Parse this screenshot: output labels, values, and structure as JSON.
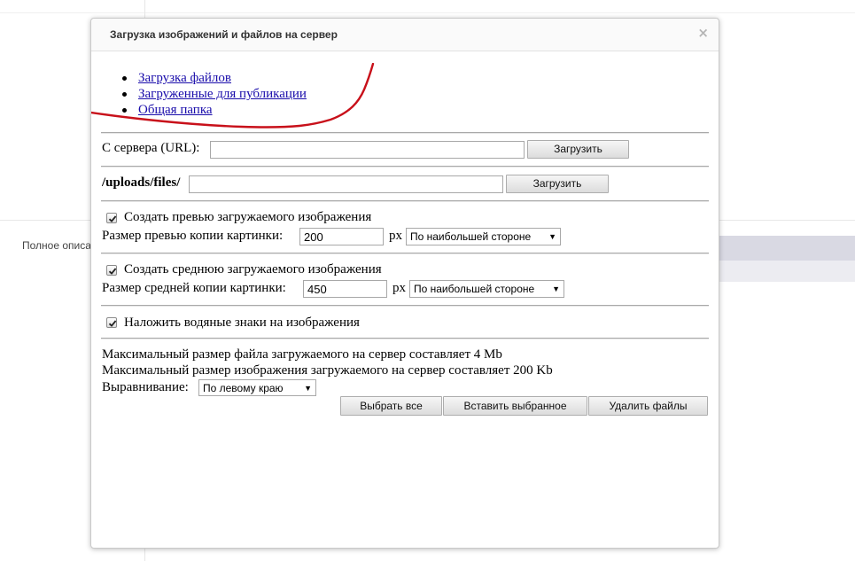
{
  "background": {
    "label": "Полное описа"
  },
  "dialog": {
    "title": "Загрузка изображений и файлов на сервер",
    "close_glyph": "×",
    "tabs": [
      {
        "label": "Загрузка файлов"
      },
      {
        "label": "Загруженные для публикации"
      },
      {
        "label": "Общая папка"
      }
    ],
    "url_upload": {
      "label": "С сервера (URL):",
      "value": "",
      "button": "Загрузить"
    },
    "path_upload": {
      "label": "/uploads/files/",
      "value": "",
      "button": "Загрузить"
    },
    "preview": {
      "checked": true,
      "checkbox_label": "Создать превью загружаемого изображения",
      "size_label": "Размер превью копии картинки:",
      "size_value": "200",
      "unit": "px",
      "mode": "По наибольшей стороне"
    },
    "medium": {
      "checked": true,
      "checkbox_label": "Создать среднюю загружаемого изображения",
      "size_label": "Размер средней копии картинки:",
      "size_value": "450",
      "unit": "px",
      "mode": "По наибольшей стороне"
    },
    "watermark": {
      "checked": true,
      "checkbox_label": "Наложить водяные знаки на изображения"
    },
    "info": {
      "max_file": "Максимальный размер файла загружаемого на сервер составляет 4 Mb",
      "max_image": "Максимальный размер изображения загружаемого на сервер составляет 200 Kb",
      "align_label": "Выравнивание:",
      "align_value": "По левому краю"
    },
    "actions": {
      "select_all": "Выбрать все",
      "insert_selected": "Вставить выбранное",
      "delete_files": "Удалить файлы"
    }
  },
  "colors": {
    "link": "#1a0dab",
    "annotation_stroke": "#c8101a"
  }
}
